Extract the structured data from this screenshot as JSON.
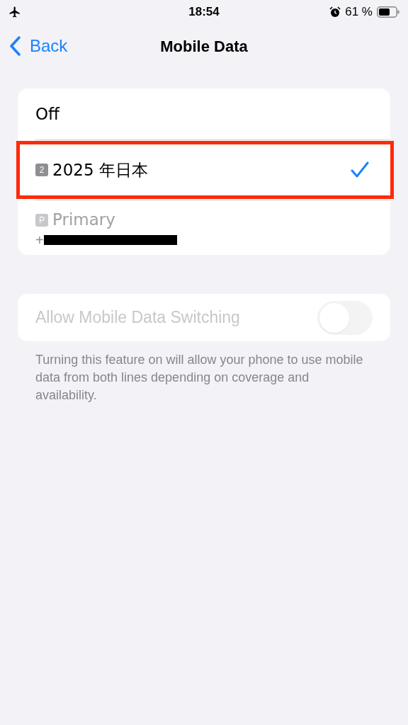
{
  "status_bar": {
    "time": "18:54",
    "battery": "61 %",
    "airplane_mode": true,
    "alarm": true
  },
  "nav": {
    "back": "Back",
    "title": "Mobile Data"
  },
  "options": [
    {
      "label": "Off",
      "selected": false,
      "disabled": false,
      "highlighted": false
    },
    {
      "label": "2025 年日本",
      "badge": "2",
      "selected": true,
      "disabled": false,
      "highlighted": true
    },
    {
      "label": "Primary",
      "badge": "P",
      "sublabel": "+",
      "sublabel_redacted": true,
      "selected": false,
      "disabled": true,
      "highlighted": false
    }
  ],
  "switching": {
    "label": "Allow Mobile Data Switching",
    "on": false,
    "disabled": true,
    "footer": "Turning this feature on will allow your phone to use mobile data from both lines depending on coverage and availability."
  }
}
